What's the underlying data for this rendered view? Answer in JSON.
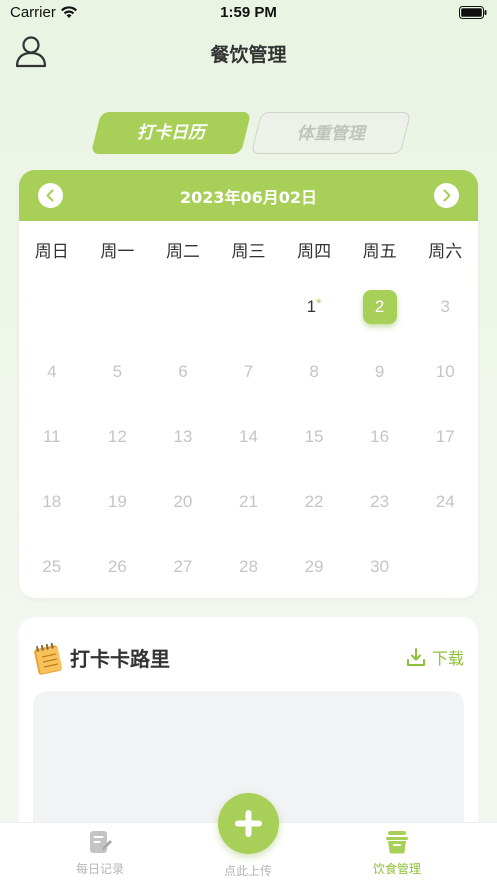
{
  "status_bar": {
    "carrier": "Carrier",
    "time": "1:59 PM"
  },
  "header": {
    "title": "餐饮管理",
    "user_icon": "user-icon"
  },
  "tabs": [
    {
      "label": "打卡日历",
      "active": true
    },
    {
      "label": "体重管理",
      "active": false
    }
  ],
  "calendar": {
    "month_label": "2023年06月02日",
    "weekdays": [
      "周日",
      "周一",
      "周二",
      "周三",
      "周四",
      "周五",
      "周六"
    ],
    "days": [
      {
        "label": "1",
        "state": "current",
        "marker": "*"
      },
      {
        "label": "2",
        "state": "selected"
      },
      {
        "label": "3",
        "state": "future"
      },
      {
        "label": "4",
        "state": "future"
      },
      {
        "label": "5",
        "state": "future"
      },
      {
        "label": "6",
        "state": "future"
      },
      {
        "label": "7",
        "state": "future"
      },
      {
        "label": "8",
        "state": "future"
      },
      {
        "label": "9",
        "state": "future"
      },
      {
        "label": "10",
        "state": "future"
      },
      {
        "label": "11",
        "state": "future"
      },
      {
        "label": "12",
        "state": "future"
      },
      {
        "label": "13",
        "state": "future"
      },
      {
        "label": "14",
        "state": "future"
      },
      {
        "label": "15",
        "state": "future"
      },
      {
        "label": "16",
        "state": "future"
      },
      {
        "label": "17",
        "state": "future"
      },
      {
        "label": "18",
        "state": "future"
      },
      {
        "label": "19",
        "state": "future"
      },
      {
        "label": "20",
        "state": "future"
      },
      {
        "label": "21",
        "state": "future"
      },
      {
        "label": "22",
        "state": "future"
      },
      {
        "label": "23",
        "state": "future"
      },
      {
        "label": "24",
        "state": "future"
      },
      {
        "label": "25",
        "state": "future"
      },
      {
        "label": "26",
        "state": "future"
      },
      {
        "label": "27",
        "state": "future"
      },
      {
        "label": "28",
        "state": "future"
      },
      {
        "label": "29",
        "state": "future"
      },
      {
        "label": "30",
        "state": "future"
      }
    ],
    "first_weekday_index": 4
  },
  "punch_section": {
    "title": "打卡卡路里",
    "download_label": "下载"
  },
  "tabbar": {
    "daily_label": "每日记录",
    "upload_label": "点此上传",
    "diet_label": "饮食管理"
  },
  "colors": {
    "accent": "#a8cf58",
    "accent_text": "#8fc03a"
  }
}
